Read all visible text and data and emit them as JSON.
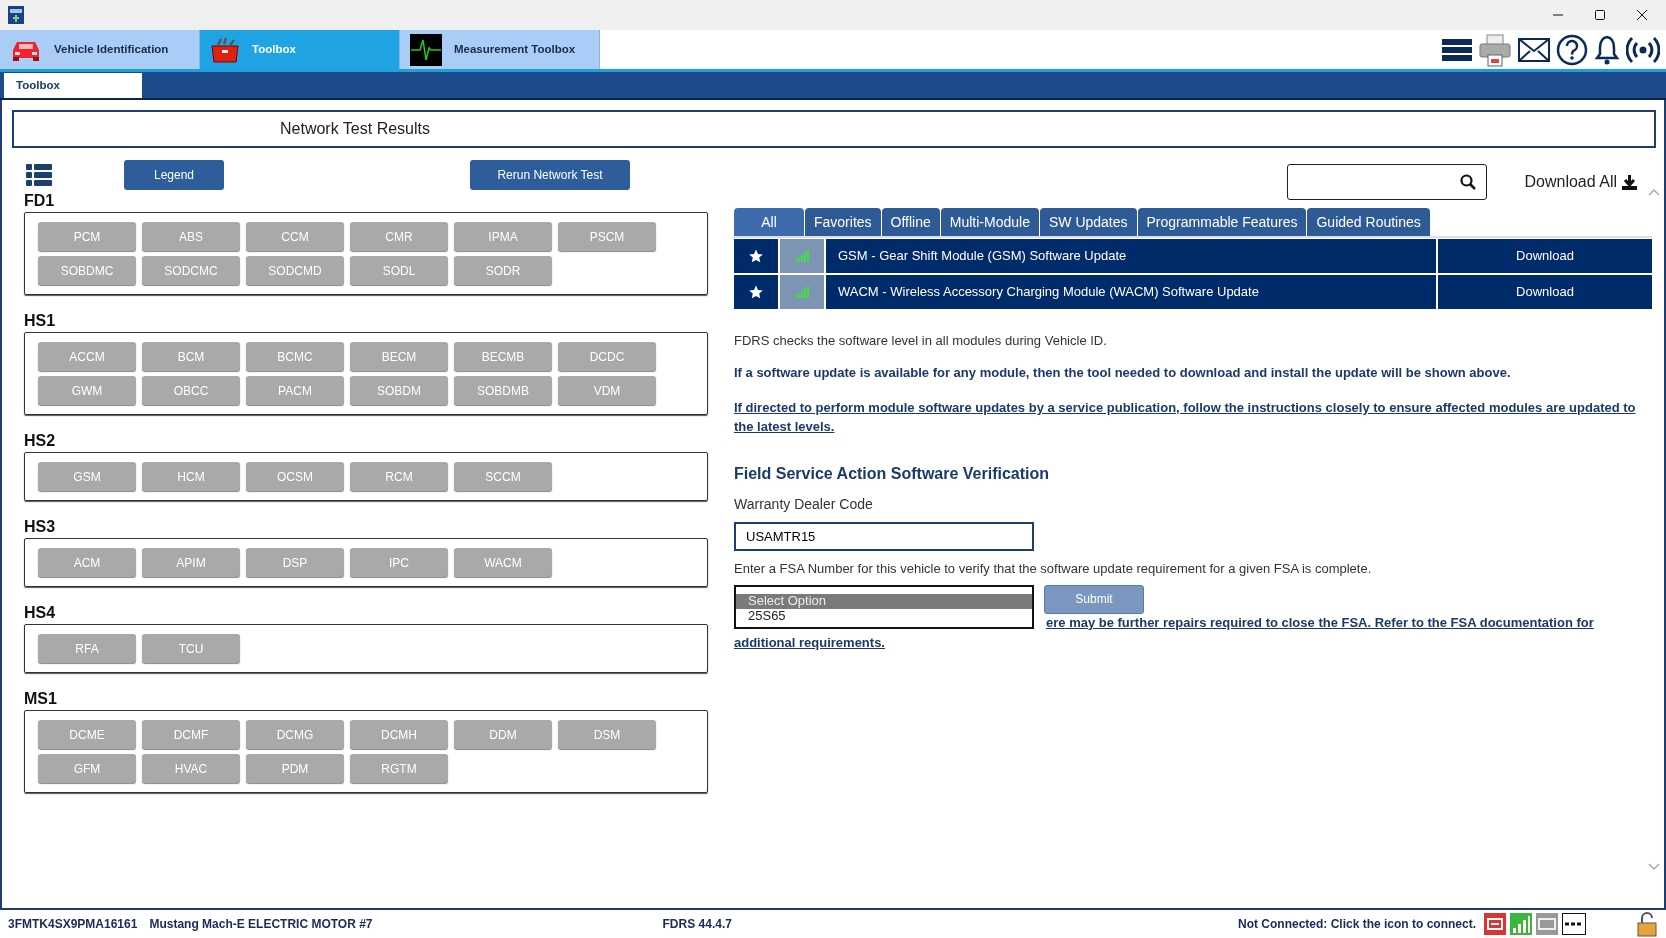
{
  "app_tabs": [
    {
      "label": "Vehicle Identification",
      "kind": "car",
      "selected": false
    },
    {
      "label": "Toolbox",
      "kind": "toolbox",
      "selected": true
    },
    {
      "label": "Measurement Toolbox",
      "kind": "scope",
      "selected": false
    }
  ],
  "sub_tabs": [
    {
      "label": "Toolbox",
      "selected": true
    }
  ],
  "page_title": "Network Test Results",
  "legend_button": "Legend",
  "rerun_button": "Rerun Network Test",
  "networks": [
    {
      "name": "FD1",
      "modules": [
        "PCM",
        "ABS",
        "CCM",
        "CMR",
        "IPMA",
        "PSCM",
        "SOBDMC",
        "SODCMC",
        "SODCMD",
        "SODL",
        "SODR"
      ]
    },
    {
      "name": "HS1",
      "modules": [
        "ACCM",
        "BCM",
        "BCMC",
        "BECM",
        "BECMB",
        "DCDC",
        "GWM",
        "OBCC",
        "PACM",
        "SOBDM",
        "SOBDMB",
        "VDM"
      ]
    },
    {
      "name": "HS2",
      "modules": [
        "GSM",
        "HCM",
        "OCSM",
        "RCM",
        "SCCM"
      ]
    },
    {
      "name": "HS3",
      "modules": [
        "ACM",
        "APIM",
        "DSP",
        "IPC",
        "WACM"
      ]
    },
    {
      "name": "HS4",
      "modules": [
        "RFA",
        "TCU"
      ]
    },
    {
      "name": "MS1",
      "modules": [
        "DCME",
        "DCMF",
        "DCMG",
        "DCMH",
        "DDM",
        "DSM",
        "GFM",
        "HVAC",
        "PDM",
        "RGTM"
      ]
    }
  ],
  "download_all": "Download All",
  "filter_tabs": [
    {
      "label": "All",
      "selected": true
    },
    {
      "label": "Favorites",
      "selected": false
    },
    {
      "label": "Offline",
      "selected": false
    },
    {
      "label": "Multi-Module",
      "selected": false
    },
    {
      "label": "SW Updates",
      "selected": false
    },
    {
      "label": "Programmable Features",
      "selected": false
    },
    {
      "label": "Guided Routines",
      "selected": false
    }
  ],
  "updates": [
    {
      "title": "GSM - Gear Shift Module (GSM) Software Update",
      "action": "Download"
    },
    {
      "title": "WACM - Wireless Accessory Charging Module (WACM) Software Update",
      "action": "Download"
    }
  ],
  "info": [
    {
      "kind": "plain",
      "text": "FDRS checks the software level in all modules during Vehicle ID."
    },
    {
      "kind": "bold",
      "text": "If a software update is available for any module, then the tool needed to download and install the update will be shown above."
    },
    {
      "kind": "link",
      "text": "If directed to perform module software updates by a service publication, follow the instructions closely to ensure affected modules are updated to the latest levels."
    }
  ],
  "fsa": {
    "heading": "Field Service Action Software Verification",
    "dealer_code_label": "Warranty Dealer Code",
    "dealer_code_value": "USAMTR15",
    "instructions": "Enter a FSA Number for this vehicle to verify that the software update requirement for a given FSA is complete.",
    "options": [
      {
        "label": "Select Option",
        "selected": true
      },
      {
        "label": "25S65",
        "selected": false
      }
    ],
    "submit": "Submit",
    "note_lines": [
      "ere may be further repairs required to close the FSA. Refer to the FSA documentation for",
      "additional requirements."
    ]
  },
  "status_bar": {
    "vin": "3FMTK4SX9PMA16161",
    "vehicle": "Mustang Mach-E ELECTRIC MOTOR #7",
    "version": "FDRS 44.4.7",
    "connection": "Not Connected: Click the icon to connect."
  }
}
